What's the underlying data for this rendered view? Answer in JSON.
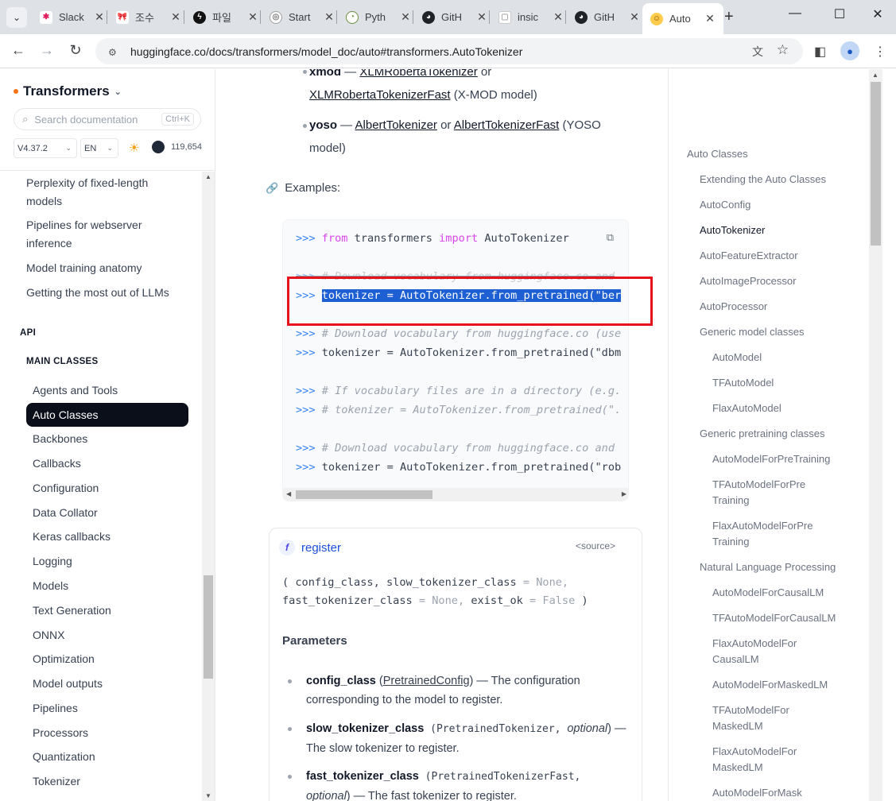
{
  "browser": {
    "tabs": [
      {
        "label": "Slack",
        "icon": "slack-icon",
        "color": "#e01e5a"
      },
      {
        "label": "조수",
        "icon": "ribbon-icon",
        "color": "#d03050"
      },
      {
        "label": "파일",
        "icon": "bolt-icon",
        "color": "#111111"
      },
      {
        "label": "Start",
        "icon": "openai-icon",
        "color": "#a0a0a0"
      },
      {
        "label": "Pyth",
        "icon": "python-icon",
        "color": "#6b8f3a"
      },
      {
        "label": "GitH",
        "icon": "github-icon",
        "color": "#1f2328"
      },
      {
        "label": "insic",
        "icon": "cube-icon",
        "color": "#c9c9c9"
      },
      {
        "label": "GitH",
        "icon": "github-icon",
        "color": "#1f2328"
      },
      {
        "label": "Auto",
        "icon": "huggingface-icon",
        "color": "#ffcc4d"
      }
    ],
    "url": "huggingface.co/docs/transformers/model_doc/auto#transformers.AutoTokenizer"
  },
  "sidebar": {
    "brand": "Transformers",
    "search_placeholder": "Search documentation",
    "search_shortcut": "Ctrl+K",
    "version": "V4.37.2",
    "language": "EN",
    "github_stars": "119,654",
    "items_top": [
      "Perplexity of fixed-length",
      "models",
      "Pipelines for webserver",
      "inference",
      "Model training anatomy",
      "Getting the most out of LLMs"
    ],
    "category_api": "API",
    "category_main": "MAIN CLASSES",
    "active_item": "Auto Classes",
    "items": [
      "Agents and Tools",
      "Backbones",
      "Callbacks",
      "Configuration",
      "Data Collator",
      "Keras callbacks",
      "Logging",
      "Models",
      "Text Generation",
      "ONNX",
      "Optimization",
      "Model outputs",
      "Pipelines",
      "Processors",
      "Quantization",
      "Tokenizer"
    ]
  },
  "main": {
    "xmod_name": "xmod",
    "xmod_sep": " — ",
    "xmod_link1": "XLMRobertaTokenizer",
    "xmod_or": " or",
    "xmod_link2": "XLMRobertaTokenizerFast",
    "xmod_desc": " (X-MOD model)",
    "yoso_name": "yoso",
    "yoso_sep": " — ",
    "yoso_link1": "AlbertTokenizer",
    "yoso_or": " or ",
    "yoso_link2": "AlbertTokenizerFast",
    "yoso_desc": " (YOSO",
    "yoso_desc2": "model)",
    "examples_label": "Examples:",
    "code": {
      "prompt": ">>>",
      "l1_kw1": "from",
      "l1_mod": " transformers ",
      "l1_kw2": "import",
      "l1_cls": " AutoTokenizer",
      "l2": "# Download vocabulary from huggingface.co and",
      "l3": "tokenizer = AutoTokenizer.from_pretrained(\"ber",
      "l4": "# Download vocabulary from huggingface.co (use",
      "l5": "tokenizer = AutoTokenizer.from_pretrained(\"dbm",
      "l6": "# If vocabulary files are in a directory (e.g.",
      "l7": "# tokenizer = AutoTokenizer.from_pretrained(\".",
      "l8": "# Download vocabulary from huggingface.co and",
      "l9": "tokenizer = AutoTokenizer.from_pretrained(\"rob"
    },
    "register": {
      "icon_letter": "f",
      "name": "register",
      "source": "<source>",
      "sig1": "( config_class, slow_tokenizer_class ",
      "sig1_eq": "= None,",
      "sig2": "fast_tokenizer_class ",
      "sig2_eq": "= None,",
      "sig2b": " exist_ok ",
      "sig2_eq2": "= False",
      "sig2_end": " )",
      "params_heading": "Parameters",
      "p1_name": "config_class",
      "p1_type_open": " (",
      "p1_type": "PretrainedConfig",
      "p1_type_close": ")",
      "p1_desc": " — The configuration",
      "p1_desc2": "corresponding to the model to register.",
      "p2_name": "slow_tokenizer_class",
      "p2_type": " (PretrainedTokenizer, ",
      "p2_opt": "optional",
      "p2_desc": ") —",
      "p2_desc2": "The slow tokenizer to register.",
      "p3_name": "fast_tokenizer_class",
      "p3_type": " (PretrainedTokenizerFast,",
      "p3_opt": "optional",
      "p3_desc": ") — The fast tokenizer to register."
    }
  },
  "toc": [
    {
      "label": "Auto Classes",
      "level": 0
    },
    {
      "label": "Extending the Auto Classes",
      "level": 1
    },
    {
      "label": "AutoConfig",
      "level": 1
    },
    {
      "label": "AutoTokenizer",
      "level": 1,
      "current": true
    },
    {
      "label": "AutoFeatureExtractor",
      "level": 1
    },
    {
      "label": "AutoImageProcessor",
      "level": 1
    },
    {
      "label": "AutoProcessor",
      "level": 1
    },
    {
      "label": "Generic model classes",
      "level": 1
    },
    {
      "label": "AutoModel",
      "level": 2
    },
    {
      "label": "TFAutoModel",
      "level": 2
    },
    {
      "label": "FlaxAutoModel",
      "level": 2
    },
    {
      "label": "Generic pretraining classes",
      "level": 1
    },
    {
      "label": "AutoModelForPreTraining",
      "level": 2
    },
    {
      "label": "TFAutoModelForPre",
      "label2": "Training",
      "level": 2
    },
    {
      "label": "FlaxAutoModelForPre",
      "label2": "Training",
      "level": 2
    },
    {
      "label": "Natural Language Processing",
      "level": 1
    },
    {
      "label": "AutoModelForCausalLM",
      "level": 2
    },
    {
      "label": "TFAutoModelForCausalLM",
      "level": 2
    },
    {
      "label": "FlaxAutoModelFor",
      "label2": "CausalLM",
      "level": 2
    },
    {
      "label": "AutoModelForMaskedLM",
      "level": 2
    },
    {
      "label": "TFAutoModelFor",
      "label2": "MaskedLM",
      "level": 2
    },
    {
      "label": "FlaxAutoModelFor",
      "label2": "MaskedLM",
      "level": 2
    },
    {
      "label": "AutoModelForMask",
      "level": 2
    }
  ]
}
